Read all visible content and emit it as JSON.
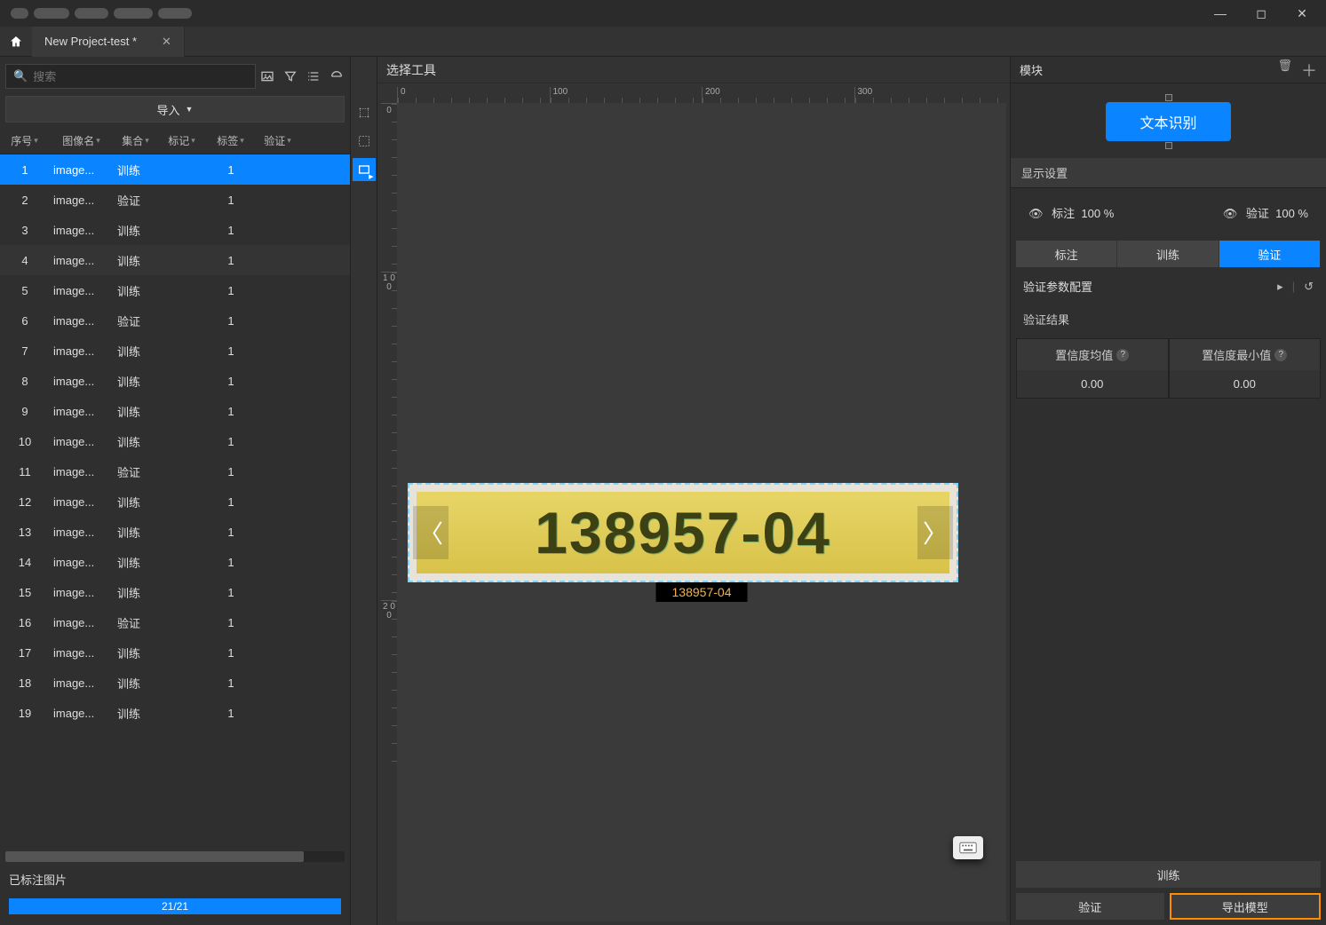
{
  "tab_title": "New Project-test *",
  "search": {
    "placeholder": "搜索"
  },
  "import_label": "导入",
  "table": {
    "headers": [
      "序号",
      "图像名",
      "集合",
      "标记",
      "标签",
      "验证"
    ],
    "rows": [
      {
        "n": "1",
        "name": "image...",
        "set": "训练",
        "mark": "",
        "tag": "1",
        "val": "",
        "sel": true
      },
      {
        "n": "2",
        "name": "image...",
        "set": "验证",
        "mark": "",
        "tag": "1",
        "val": ""
      },
      {
        "n": "3",
        "name": "image...",
        "set": "训练",
        "mark": "",
        "tag": "1",
        "val": ""
      },
      {
        "n": "4",
        "name": "image...",
        "set": "训练",
        "mark": "",
        "tag": "1",
        "val": "",
        "alt": true
      },
      {
        "n": "5",
        "name": "image...",
        "set": "训练",
        "mark": "",
        "tag": "1",
        "val": ""
      },
      {
        "n": "6",
        "name": "image...",
        "set": "验证",
        "mark": "",
        "tag": "1",
        "val": ""
      },
      {
        "n": "7",
        "name": "image...",
        "set": "训练",
        "mark": "",
        "tag": "1",
        "val": ""
      },
      {
        "n": "8",
        "name": "image...",
        "set": "训练",
        "mark": "",
        "tag": "1",
        "val": ""
      },
      {
        "n": "9",
        "name": "image...",
        "set": "训练",
        "mark": "",
        "tag": "1",
        "val": ""
      },
      {
        "n": "10",
        "name": "image...",
        "set": "训练",
        "mark": "",
        "tag": "1",
        "val": ""
      },
      {
        "n": "11",
        "name": "image...",
        "set": "验证",
        "mark": "",
        "tag": "1",
        "val": ""
      },
      {
        "n": "12",
        "name": "image...",
        "set": "训练",
        "mark": "",
        "tag": "1",
        "val": ""
      },
      {
        "n": "13",
        "name": "image...",
        "set": "训练",
        "mark": "",
        "tag": "1",
        "val": ""
      },
      {
        "n": "14",
        "name": "image...",
        "set": "训练",
        "mark": "",
        "tag": "1",
        "val": ""
      },
      {
        "n": "15",
        "name": "image...",
        "set": "训练",
        "mark": "",
        "tag": "1",
        "val": ""
      },
      {
        "n": "16",
        "name": "image...",
        "set": "验证",
        "mark": "",
        "tag": "1",
        "val": ""
      },
      {
        "n": "17",
        "name": "image...",
        "set": "训练",
        "mark": "",
        "tag": "1",
        "val": ""
      },
      {
        "n": "18",
        "name": "image...",
        "set": "训练",
        "mark": "",
        "tag": "1",
        "val": ""
      },
      {
        "n": "19",
        "name": "image...",
        "set": "训练",
        "mark": "",
        "tag": "1",
        "val": ""
      }
    ]
  },
  "status_label": "已标注图片",
  "progress_text": "21/21",
  "center": {
    "title": "选择工具",
    "ruler_h": [
      "0",
      "100",
      "200",
      "300"
    ],
    "ruler_v": [
      "0",
      "1 0 0",
      "2 0 0"
    ],
    "image_text": "138957-04",
    "label_text": "138957-04"
  },
  "right": {
    "title": "模块",
    "module_label": "文本识别",
    "display_settings": "显示设置",
    "vis": {
      "annot_label": "标注",
      "annot_pct": "100 %",
      "valid_label": "验证",
      "valid_pct": "100 %"
    },
    "tabs": [
      "标注",
      "训练",
      "验证"
    ],
    "config_label": "验证参数配置",
    "result_label": "验证结果",
    "metric1_label": "置信度均值",
    "metric1_val": "0.00",
    "metric2_label": "置信度最小值",
    "metric2_val": "0.00",
    "btn_train": "训练",
    "btn_valid": "验证",
    "btn_export": "导出模型"
  }
}
